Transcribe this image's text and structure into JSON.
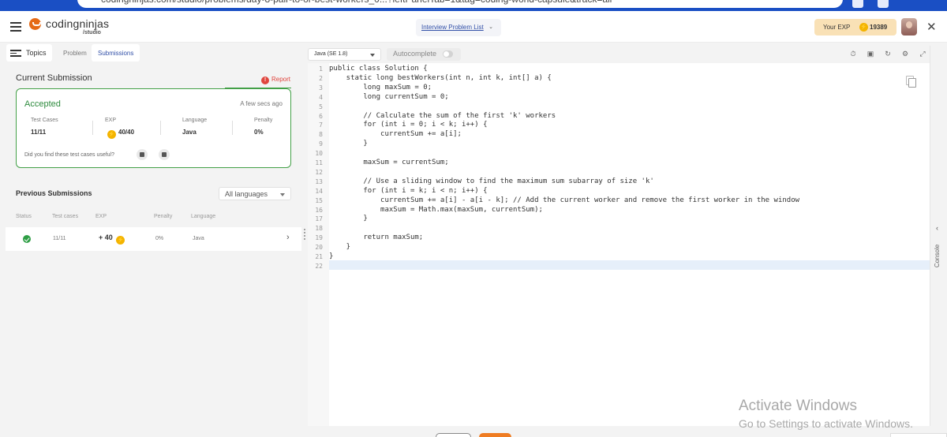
{
  "browser": {
    "url": "codingninjas.com/studio/problems/day-8-pair-to-or-best-workers_0...?leftPanelTab=1&tag=coding-world-capsule&track=all"
  },
  "header": {
    "logo_name": "codingninjas",
    "logo_sub": "/studio",
    "problem_list": "Interview Problem List",
    "exp_label": "Your EXP",
    "exp_value": "19389"
  },
  "left_tabs": {
    "topics": "Topics",
    "problem": "Problem",
    "submissions": "Submissions"
  },
  "current_submission": {
    "title": "Current Submission",
    "report": "Report",
    "status": "Accepted",
    "time": "A few secs ago",
    "stats": [
      {
        "label": "Test Cases",
        "value": "11/11"
      },
      {
        "label": "EXP",
        "value": "40/40"
      },
      {
        "label": "Language",
        "value": "Java"
      },
      {
        "label": "Penalty",
        "value": "0%"
      }
    ],
    "feedback_question": "Did you find these test cases useful?"
  },
  "previous_submissions": {
    "title": "Previous Submissions",
    "filter": "All languages",
    "columns": [
      "Status",
      "Test cases",
      "EXP",
      "Penalty",
      "Language"
    ],
    "rows": [
      {
        "status": "accepted",
        "test_cases": "11/11",
        "exp": "+ 40",
        "penalty": "0%",
        "language": "Java"
      }
    ]
  },
  "editor": {
    "language": "Java (SE 1.8)",
    "autocomplete": "Autocomplete",
    "autocomplete_on": false,
    "line_numbers": [
      "1",
      "2",
      "3",
      "4",
      "5",
      "6",
      "7",
      "8",
      "9",
      "10",
      "11",
      "12",
      "13",
      "14",
      "15",
      "16",
      "17",
      "18",
      "19",
      "20",
      "21",
      "22"
    ],
    "code": [
      "public class Solution {",
      "    static long bestWorkers(int n, int k, int[] a) {",
      "        long maxSum = 0;",
      "        long currentSum = 0;",
      "",
      "        // Calculate the sum of the first 'k' workers",
      "        for (int i = 0; i < k; i++) {",
      "            currentSum += a[i];",
      "        }",
      "",
      "        maxSum = currentSum;",
      "",
      "        // Use a sliding window to find the maximum sum subarray of size 'k'",
      "        for (int i = k; i < n; i++) {",
      "            currentSum += a[i] - a[i - k]; // Add the current worker and remove the first worker in the window",
      "            maxSum = Math.max(maxSum, currentSum);",
      "        }",
      "",
      "        return maxSum;",
      "    }",
      "}",
      ""
    ],
    "active_line": 22
  },
  "console": {
    "label": "Console"
  },
  "watermark": {
    "line1": "Activate Windows",
    "line2": "Go to Settings to activate Windows."
  },
  "colors": {
    "accent_blue": "#3250a8",
    "success_green": "#43a047",
    "exp_bg": "#f9e1b6",
    "report_red": "#e0463e"
  },
  "icons": [
    "hamburger-icon",
    "coin-icon",
    "close-icon",
    "report-icon",
    "thumbs-up-icon",
    "thumbs-down-icon",
    "check-circle-icon",
    "chevron-right-icon",
    "timer-icon",
    "save-icon",
    "reset-icon",
    "settings-icon",
    "fullscreen-icon",
    "copy-icon"
  ]
}
